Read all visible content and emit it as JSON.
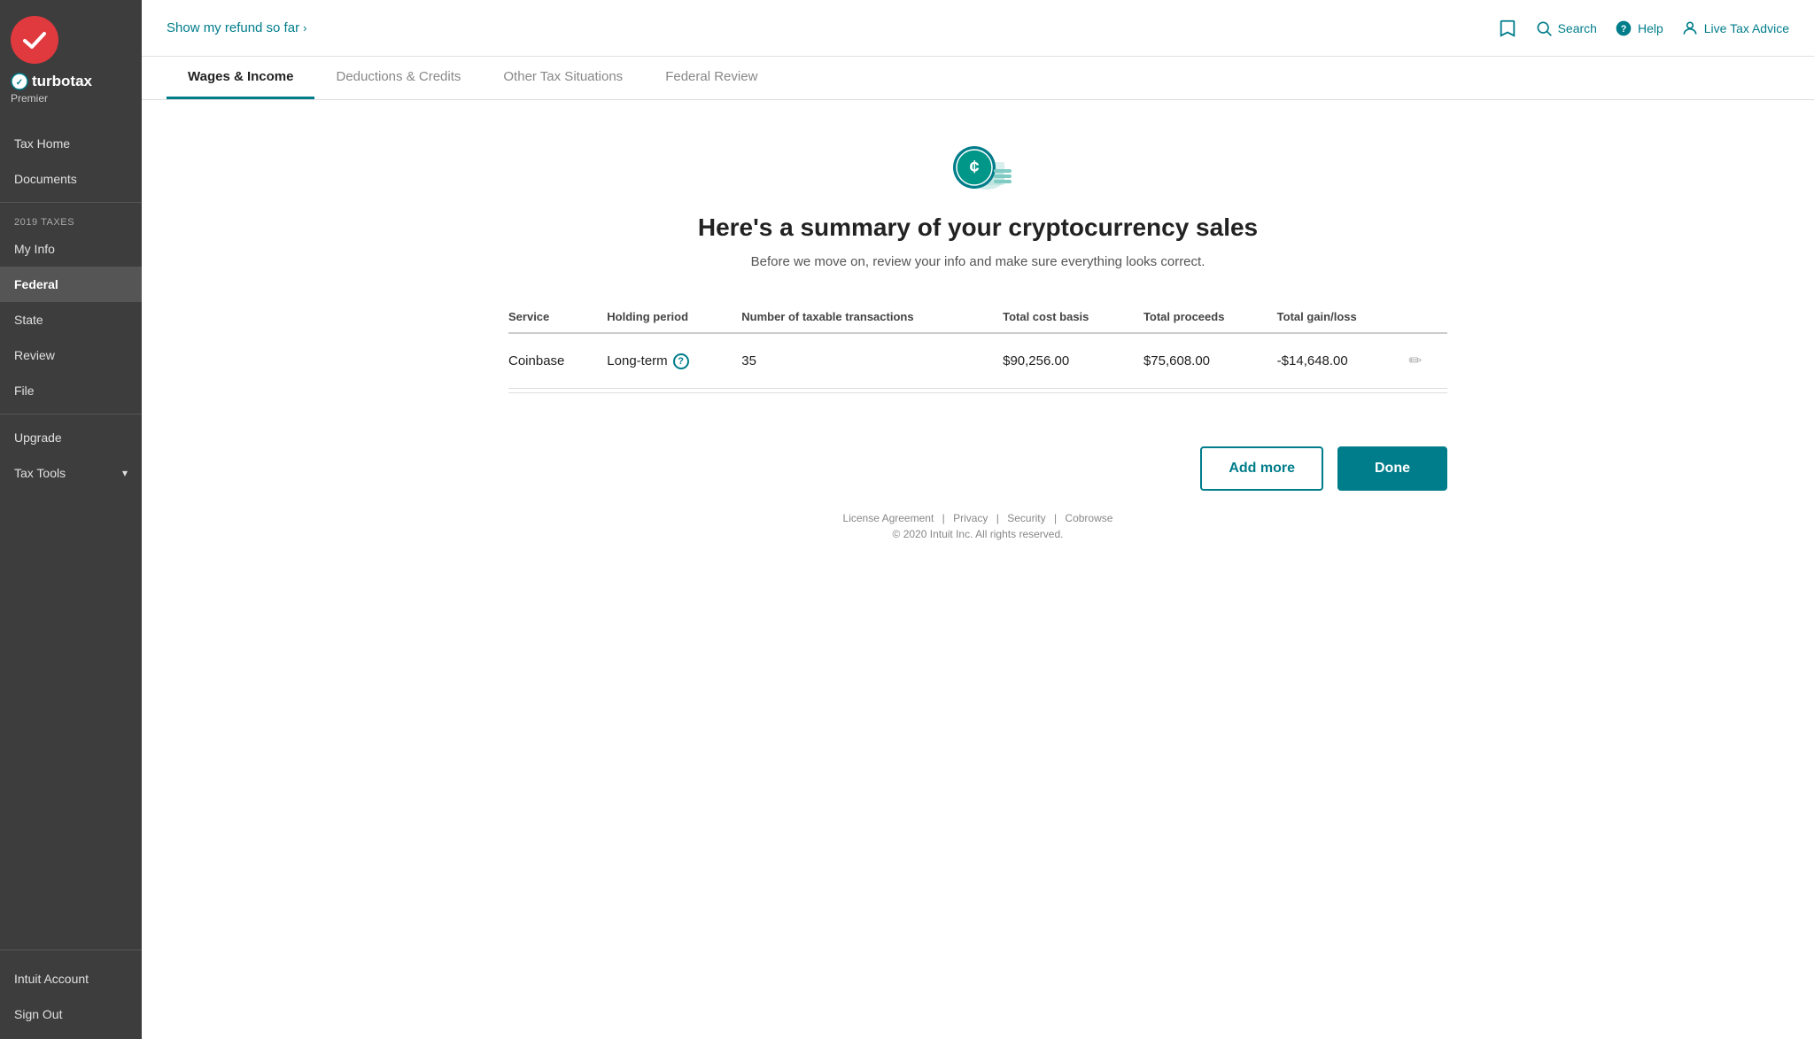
{
  "sidebar": {
    "brand": "turbotax",
    "tier": "Premier",
    "nav_items": [
      {
        "id": "tax-home",
        "label": "Tax Home",
        "active": false
      },
      {
        "id": "documents",
        "label": "Documents",
        "active": false
      }
    ],
    "section_label": "2019 TAXES",
    "tax_items": [
      {
        "id": "my-info",
        "label": "My Info",
        "active": false
      },
      {
        "id": "federal",
        "label": "Federal",
        "active": true
      },
      {
        "id": "state",
        "label": "State",
        "active": false
      },
      {
        "id": "review",
        "label": "Review",
        "active": false
      },
      {
        "id": "file",
        "label": "File",
        "active": false
      }
    ],
    "tools_label": "Tax Tools",
    "upgrade_label": "Upgrade",
    "bottom_items": [
      {
        "id": "intuit-account",
        "label": "Intuit Account"
      },
      {
        "id": "sign-out",
        "label": "Sign Out"
      }
    ]
  },
  "topbar": {
    "refund_link": "Show my refund so far",
    "search_label": "Search",
    "help_label": "Help",
    "live_advice_label": "Live Tax Advice"
  },
  "nav_tabs": [
    {
      "id": "wages-income",
      "label": "Wages & Income",
      "active": true
    },
    {
      "id": "deductions-credits",
      "label": "Deductions & Credits",
      "active": false
    },
    {
      "id": "other-tax",
      "label": "Other Tax Situations",
      "active": false
    },
    {
      "id": "federal-review",
      "label": "Federal Review",
      "active": false
    }
  ],
  "page": {
    "title": "Here's a summary of your cryptocurrency sales",
    "subtitle": "Before we move on, review your info and make sure everything looks correct."
  },
  "table": {
    "headers": [
      "Service",
      "Holding period",
      "Number of taxable transactions",
      "Total cost basis",
      "Total proceeds",
      "Total gain/loss",
      ""
    ],
    "rows": [
      {
        "service": "Coinbase",
        "holding_period": "Long-term",
        "transactions": "35",
        "cost_basis": "$90,256.00",
        "proceeds": "$75,608.00",
        "gain_loss": "-$14,648.00"
      }
    ]
  },
  "buttons": {
    "add_more": "Add more",
    "done": "Done"
  },
  "footer": {
    "links": [
      "License Agreement",
      "Privacy",
      "Security",
      "Cobrowse"
    ],
    "copyright": "© 2020 Intuit Inc. All rights reserved."
  },
  "colors": {
    "teal": "#007d8a",
    "dark_sidebar": "#3d3d3d",
    "red_logo": "#e0393e"
  }
}
